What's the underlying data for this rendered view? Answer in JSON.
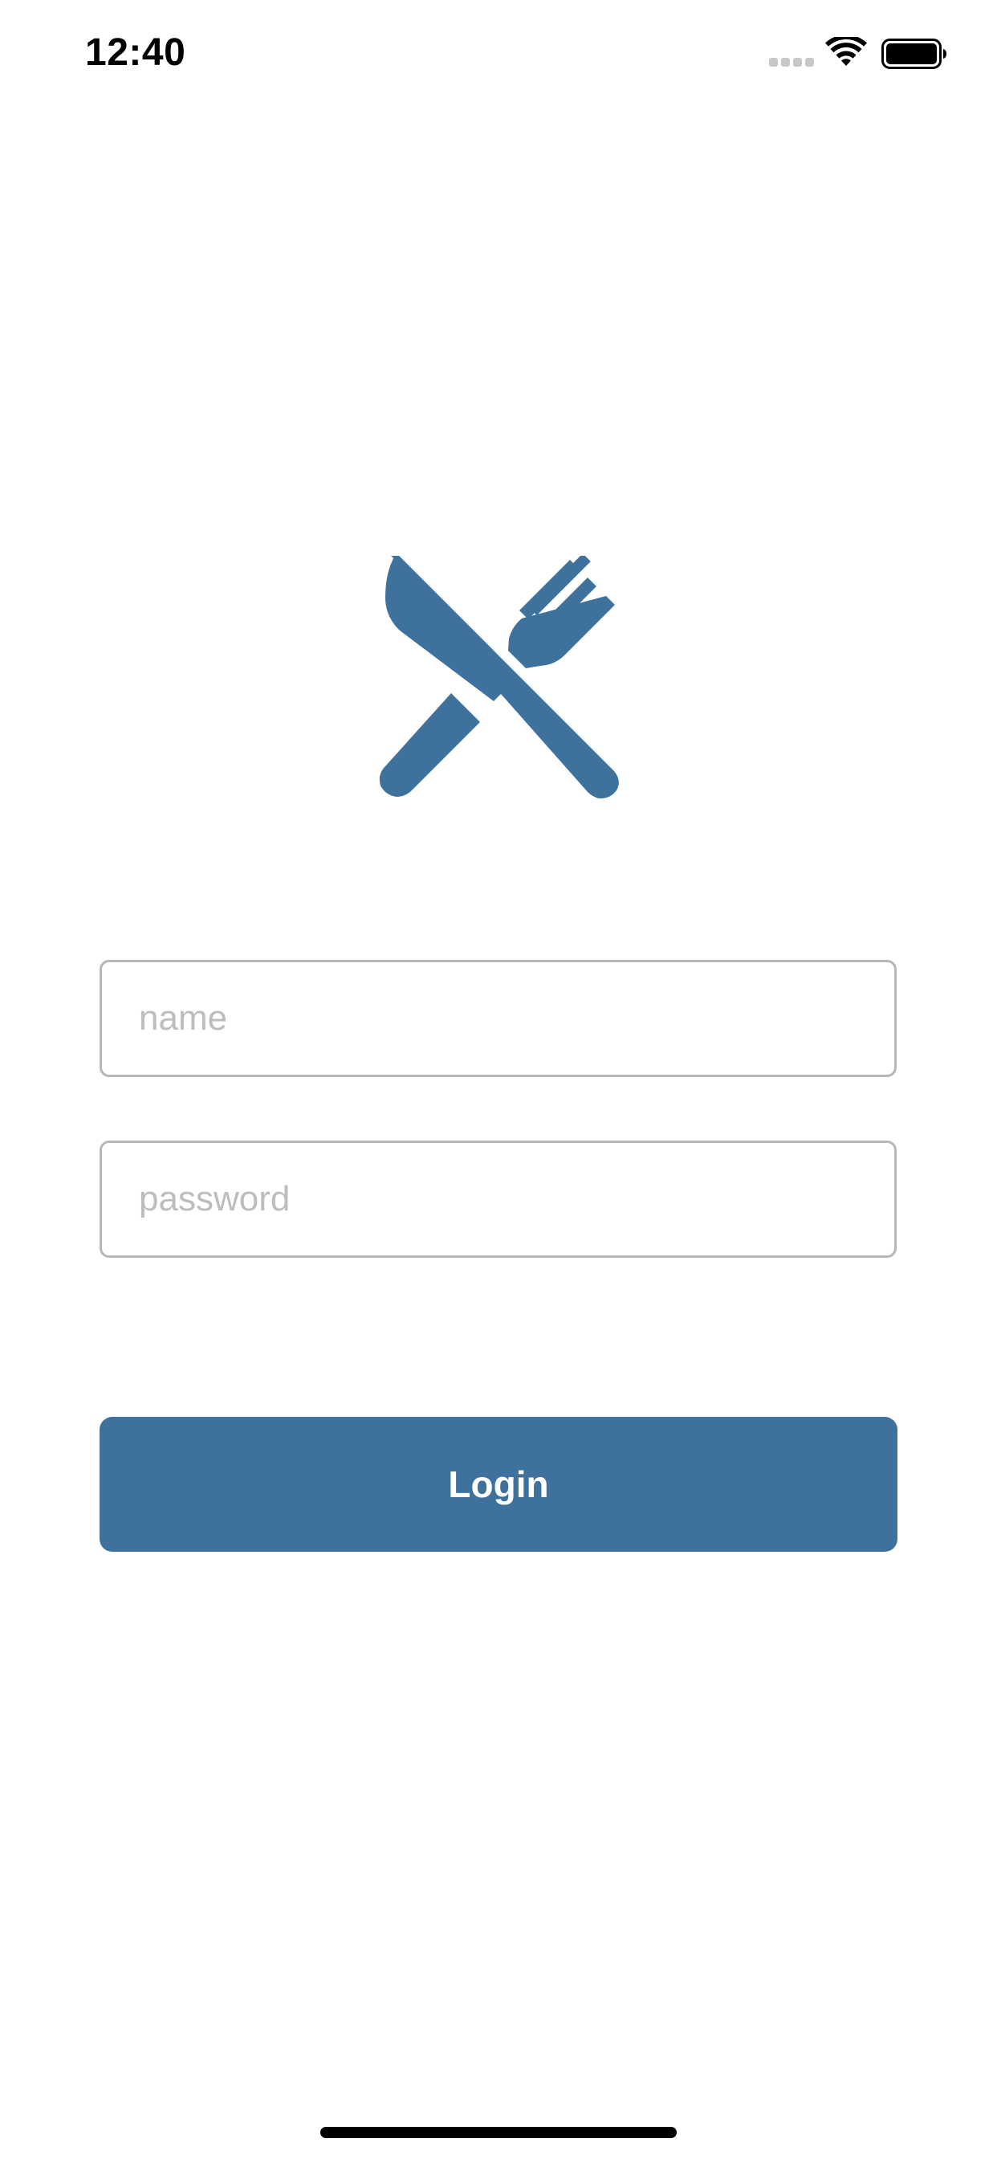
{
  "status_bar": {
    "time": "12:40"
  },
  "logo": {
    "icon": "fork-and-knife-icon",
    "color": "#3e729c"
  },
  "form": {
    "name_placeholder": "name",
    "name_value": "",
    "password_placeholder": "password",
    "password_value": "",
    "login_label": "Login"
  },
  "colors": {
    "accent": "#3e729c",
    "input_border": "#b7b7b7",
    "placeholder": "#bdbdbd",
    "background": "#ffffff"
  }
}
